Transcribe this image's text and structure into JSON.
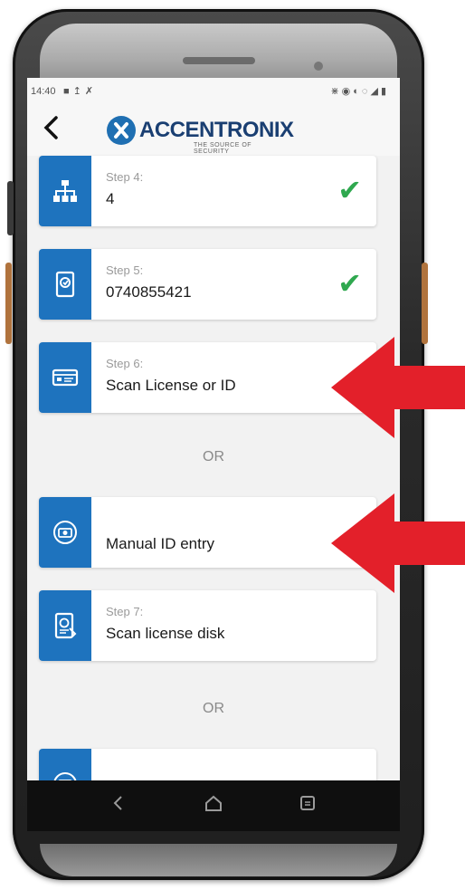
{
  "status_bar": {
    "time": "14:40",
    "left_icons": [
      "notification-icon",
      "upload-icon",
      "tool-icon"
    ],
    "right_icons": [
      "bluetooth-icon",
      "location-icon",
      "sync-icon",
      "wifi-icon",
      "signal-icon",
      "battery-icon"
    ]
  },
  "app_bar": {
    "back_icon": "chevron-left-icon",
    "logo_text": "ACCENTRONIX",
    "logo_subtitle": "THE SOURCE OF SECURITY"
  },
  "steps": [
    {
      "label": "Step 4:",
      "value": "4",
      "icon": "sitemap-icon",
      "completed": true
    },
    {
      "label": "Step 5:",
      "value": "0740855421",
      "icon": "phone-verify-icon",
      "completed": true
    },
    {
      "label": "Step 6:",
      "value": "Scan License or ID",
      "icon": "id-card-icon",
      "completed": false
    },
    {
      "label": "",
      "value": "Manual ID entry",
      "icon": "camera-icon",
      "completed": false
    },
    {
      "label": "Step 7:",
      "value": "Scan license disk",
      "icon": "disk-scan-icon",
      "completed": false
    }
  ],
  "or_label": "OR",
  "nav": {
    "back": "back-icon",
    "home": "home-icon",
    "recents": "recents-icon"
  },
  "colors": {
    "primary": "#1e73be",
    "check": "#2fa84f",
    "arrow": "#e3202a",
    "logo_text": "#1a3f72"
  }
}
